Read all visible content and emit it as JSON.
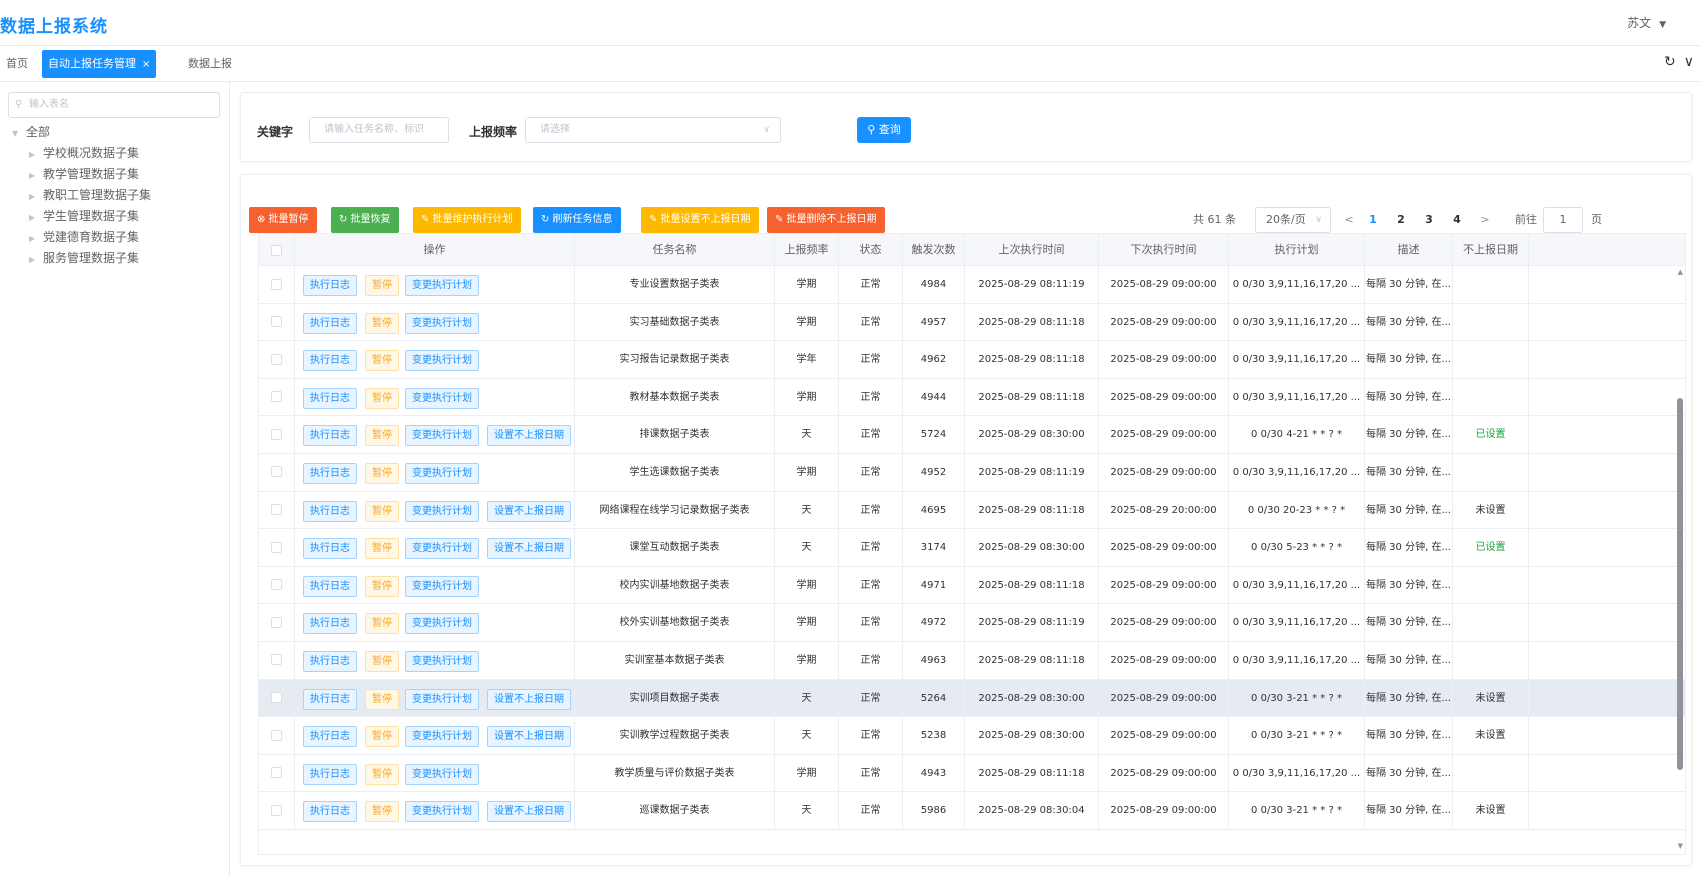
{
  "header": {
    "title": "数据上报系统",
    "user": "苏文",
    "caret": "▼"
  },
  "tabs": [
    {
      "label": "首页"
    },
    {
      "label": "自动上报任务管理",
      "close": "×"
    },
    {
      "label": "数据上报"
    }
  ],
  "tabs_tools": {
    "refresh": "↻",
    "collapse": "∨"
  },
  "sidebar": {
    "search_placeholder": "输入表名",
    "root": "全部",
    "items": [
      "学校概况数据子集",
      "教学管理数据子集",
      "教职工管理数据子集",
      "学生管理数据子集",
      "党建德育数据子集",
      "服务管理数据子集"
    ]
  },
  "filter": {
    "keyword_label": "关键字",
    "keyword_placeholder": "请输入任务名称、标识",
    "freq_label": "上报频率",
    "freq_placeholder": "请选择",
    "query_label": "查询",
    "query_icon": "search-icon"
  },
  "toolbar": {
    "buttons": [
      {
        "label": "⊗ 批量暂停",
        "color": "#f5622f"
      },
      {
        "label": "↻ 批量恢复",
        "color": "#4caf50"
      },
      {
        "label": "✎ 批量维护执行计划",
        "color": "#ffb800"
      },
      {
        "label": "↻ 刷新任务信息",
        "color": "#1890ff"
      },
      {
        "label": "✎ 批量设置不上报日期",
        "color": "#ffb800"
      },
      {
        "label": "✎ 批量删除不上报日期",
        "color": "#f5622f"
      }
    ]
  },
  "pagination": {
    "total": "共 61 条",
    "page_size": "20条/页",
    "prev": "<",
    "pages": [
      "1",
      "2",
      "3",
      "4"
    ],
    "active_page": "1",
    "next": ">",
    "goto_label": "前往",
    "goto_value": "1",
    "goto_suffix": "页"
  },
  "table": {
    "columns": [
      "操作",
      "任务名称",
      "上报频率",
      "状态",
      "触发次数",
      "上次执行时间",
      "下次执行时间",
      "执行计划",
      "描述",
      "不上报日期"
    ],
    "action_labels": {
      "log": "执行日志",
      "pause": "暂停",
      "plan": "变更执行计划",
      "set_date": "设置不上报日期"
    },
    "rows": [
      {
        "name": "专业设置数据子类表",
        "freq": "学期",
        "status": "正常",
        "count": "4984",
        "last": "2025-08-29 08:11:19",
        "next": "2025-08-29 09:00:00",
        "plan": "0 0/30 3,9,11,16,17,20 ...",
        "desc": "每隔 30 分钟, 在...",
        "flag": "",
        "has_set": false
      },
      {
        "name": "实习基础数据子类表",
        "freq": "学期",
        "status": "正常",
        "count": "4957",
        "last": "2025-08-29 08:11:18",
        "next": "2025-08-29 09:00:00",
        "plan": "0 0/30 3,9,11,16,17,20 ...",
        "desc": "每隔 30 分钟, 在...",
        "flag": "",
        "has_set": false
      },
      {
        "name": "实习报告记录数据子类表",
        "freq": "学年",
        "status": "正常",
        "count": "4962",
        "last": "2025-08-29 08:11:18",
        "next": "2025-08-29 09:00:00",
        "plan": "0 0/30 3,9,11,16,17,20 ...",
        "desc": "每隔 30 分钟, 在...",
        "flag": "",
        "has_set": false
      },
      {
        "name": "教材基本数据子类表",
        "freq": "学期",
        "status": "正常",
        "count": "4944",
        "last": "2025-08-29 08:11:18",
        "next": "2025-08-29 09:00:00",
        "plan": "0 0/30 3,9,11,16,17,20 ...",
        "desc": "每隔 30 分钟, 在...",
        "flag": "",
        "has_set": false
      },
      {
        "name": "排课数据子类表",
        "freq": "天",
        "status": "正常",
        "count": "5724",
        "last": "2025-08-29 08:30:00",
        "next": "2025-08-29 09:00:00",
        "plan": "0 0/30 4-21 * * ? *",
        "desc": "每隔 30 分钟, 在...",
        "flag": "已设置",
        "has_set": true
      },
      {
        "name": "学生选课数据子类表",
        "freq": "学期",
        "status": "正常",
        "count": "4952",
        "last": "2025-08-29 08:11:19",
        "next": "2025-08-29 09:00:00",
        "plan": "0 0/30 3,9,11,16,17,20 ...",
        "desc": "每隔 30 分钟, 在...",
        "flag": "",
        "has_set": false
      },
      {
        "name": "网络课程在线学习记录数据子类表",
        "freq": "天",
        "status": "正常",
        "count": "4695",
        "last": "2025-08-29 08:11:18",
        "next": "2025-08-29 20:00:00",
        "plan": "0 0/30 20-23 * * ? *",
        "desc": "每隔 30 分钟, 在...",
        "flag": "未设置",
        "has_set": true
      },
      {
        "name": "课堂互动数据子类表",
        "freq": "天",
        "status": "正常",
        "count": "3174",
        "last": "2025-08-29 08:30:00",
        "next": "2025-08-29 09:00:00",
        "plan": "0 0/30 5-23 * * ? *",
        "desc": "每隔 30 分钟, 在...",
        "flag": "已设置",
        "has_set": true
      },
      {
        "name": "校内实训基地数据子类表",
        "freq": "学期",
        "status": "正常",
        "count": "4971",
        "last": "2025-08-29 08:11:18",
        "next": "2025-08-29 09:00:00",
        "plan": "0 0/30 3,9,11,16,17,20 ...",
        "desc": "每隔 30 分钟, 在...",
        "flag": "",
        "has_set": false
      },
      {
        "name": "校外实训基地数据子类表",
        "freq": "学期",
        "status": "正常",
        "count": "4972",
        "last": "2025-08-29 08:11:19",
        "next": "2025-08-29 09:00:00",
        "plan": "0 0/30 3,9,11,16,17,20 ...",
        "desc": "每隔 30 分钟, 在...",
        "flag": "",
        "has_set": false
      },
      {
        "name": "实训室基本数据子类表",
        "freq": "学期",
        "status": "正常",
        "count": "4963",
        "last": "2025-08-29 08:11:18",
        "next": "2025-08-29 09:00:00",
        "plan": "0 0/30 3,9,11,16,17,20 ...",
        "desc": "每隔 30 分钟, 在...",
        "flag": "",
        "has_set": false
      },
      {
        "name": "实训项目数据子类表",
        "freq": "天",
        "status": "正常",
        "count": "5264",
        "last": "2025-08-29 08:30:00",
        "next": "2025-08-29 09:00:00",
        "plan": "0 0/30 3-21 * * ? *",
        "desc": "每隔 30 分钟, 在...",
        "flag": "未设置",
        "has_set": true,
        "highlight": true
      },
      {
        "name": "实训教学过程数据子类表",
        "freq": "天",
        "status": "正常",
        "count": "5238",
        "last": "2025-08-29 08:30:00",
        "next": "2025-08-29 09:00:00",
        "plan": "0 0/30 3-21 * * ? *",
        "desc": "每隔 30 分钟, 在...",
        "flag": "未设置",
        "has_set": true
      },
      {
        "name": "教学质量与评价数据子类表",
        "freq": "学期",
        "status": "正常",
        "count": "4943",
        "last": "2025-08-29 08:11:18",
        "next": "2025-08-29 09:00:00",
        "plan": "0 0/30 3,9,11,16,17,20 ...",
        "desc": "每隔 30 分钟, 在...",
        "flag": "",
        "has_set": false
      },
      {
        "name": "巡课数据子类表",
        "freq": "天",
        "status": "正常",
        "count": "5986",
        "last": "2025-08-29 08:30:04",
        "next": "2025-08-29 09:00:00",
        "plan": "0 0/30 3-21 * * ? *",
        "desc": "每隔 30 分钟, 在...",
        "flag": "未设置",
        "has_set": true
      }
    ]
  },
  "colors": {
    "primary": "#1890ff",
    "warning": "#ffb800",
    "danger": "#f5622f",
    "success": "#4caf50",
    "set_flag": "#13a536"
  }
}
